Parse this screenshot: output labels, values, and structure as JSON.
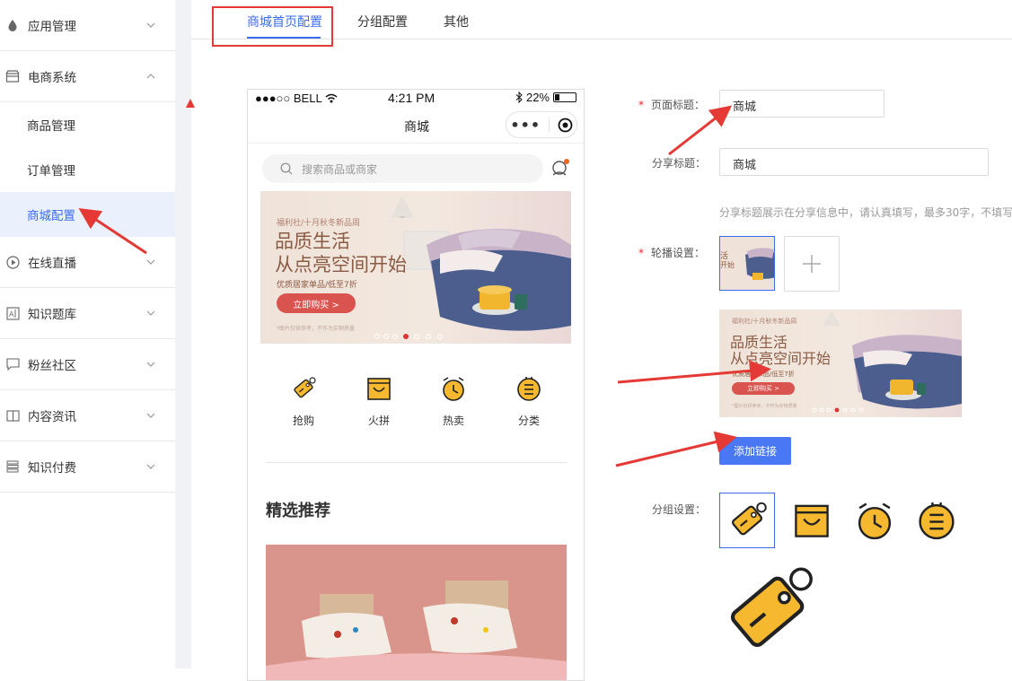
{
  "sidebar": {
    "groups": [
      {
        "label": "应用管理",
        "icon": "drop-icon"
      },
      {
        "label": "电商系统",
        "icon": "shop-icon",
        "expanded": true,
        "items": [
          "商品管理",
          "订单管理",
          "商城配置"
        ],
        "active_item": "商城配置"
      },
      {
        "label": "在线直播",
        "icon": "play-circle-icon"
      },
      {
        "label": "知识题库",
        "icon": "exam-icon"
      },
      {
        "label": "粉丝社区",
        "icon": "chat-icon"
      },
      {
        "label": "内容资讯",
        "icon": "book-icon"
      },
      {
        "label": "知识付费",
        "icon": "list-icon"
      }
    ]
  },
  "tabs": [
    {
      "label": "商城首页配置",
      "active": true
    },
    {
      "label": "分组配置",
      "active": false
    },
    {
      "label": "其他",
      "active": false
    }
  ],
  "phone": {
    "status": {
      "carrier": "●●●○○ BELL",
      "time": "4:21 PM",
      "battery": "22%"
    },
    "title": "商城",
    "search_placeholder": "搜索商品或商家",
    "banner": {
      "tag": "福利社/十月秋冬新品周",
      "title_line1": "品质生活",
      "title_line2": "从点亮空间开始",
      "subtitle": "优质居家单品/低至7折",
      "button": "立即购买 >",
      "footnote": "*图片仅供参考，不作为实物质量"
    },
    "categories": [
      {
        "label": "抢购",
        "icon": "tag-icon"
      },
      {
        "label": "火拼",
        "icon": "box-icon"
      },
      {
        "label": "热卖",
        "icon": "alarm-icon"
      },
      {
        "label": "分类",
        "icon": "menu-list-icon"
      }
    ],
    "section_title": "精选推荐"
  },
  "form": {
    "page_title_label": "页面标题：",
    "page_title_value": "商城",
    "share_title_label": "分享标题：",
    "share_title_value": "商城",
    "share_hint": "分享标题展示在分享信息中，请认真填写，最多30字，不填写",
    "carousel_label": "轮播设置：",
    "add_link_button": "添加链接",
    "group_label": "分组设置："
  },
  "colors": {
    "accent": "#3b6cf0",
    "annotation": "#e53935",
    "icon_yellow": "#f5b82e"
  }
}
